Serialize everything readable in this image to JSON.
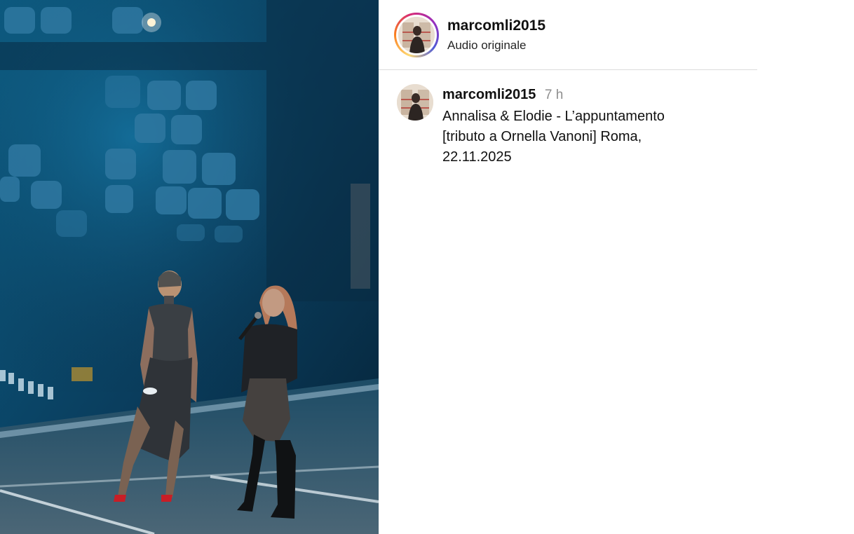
{
  "post": {
    "username": "marcomli2015",
    "audio_label": "Audio originale"
  },
  "caption": {
    "username": "marcomli2015",
    "time_ago": "7 h",
    "line1": "Annalisa & Elodie - L’appuntamento",
    "line2": "[tributo a Ornella Vanoni] Roma,",
    "line3": "22.11.2025"
  },
  "colors": {
    "stage_blue": "#0b4a6e",
    "seat_blue": "#2d6d92",
    "floor": "#3b5e72",
    "text_primary": "#111111",
    "text_muted": "#8e8e8e",
    "divider": "#dbdbdb"
  },
  "icons": {
    "profile_ring": "instagram-story-ring-icon"
  }
}
